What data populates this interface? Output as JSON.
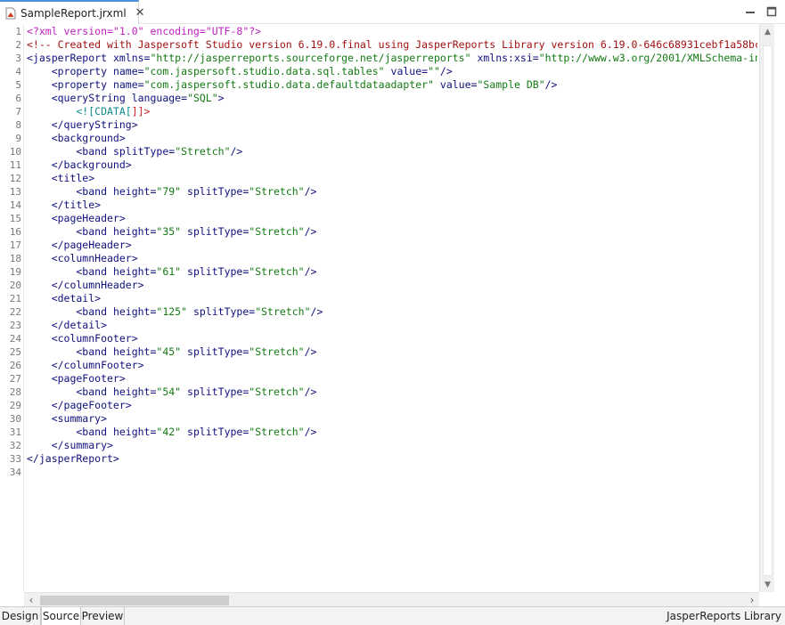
{
  "tab": {
    "filename": "SampleReport.jrxml",
    "icon": "jasper-report-icon",
    "close_icon": "close-icon"
  },
  "window_controls": [
    "minimize-icon",
    "maximize-icon"
  ],
  "line_numbers": [
    "1",
    "2",
    "3",
    "4",
    "5",
    "6",
    "7",
    "8",
    "9",
    "10",
    "11",
    "12",
    "13",
    "14",
    "15",
    "16",
    "17",
    "18",
    "19",
    "20",
    "21",
    "22",
    "23",
    "24",
    "25",
    "26",
    "27",
    "28",
    "29",
    "30",
    "31",
    "32",
    "33",
    "34"
  ],
  "code_lines": [
    [
      {
        "t": "<?xml version=\"1.0\" encoding=\"UTF-8\"?>",
        "c": "pi"
      }
    ],
    [
      {
        "t": "<!-- Created with Jaspersoft Studio version 6.19.0.final using JasperReports Library version 6.19.0-646c68931cebf1a58bc",
        "c": "comment"
      }
    ],
    [
      {
        "t": "<jasperReport ",
        "c": "tag"
      },
      {
        "t": "xmlns=",
        "c": "attr"
      },
      {
        "t": "\"http://jasperreports.sourceforge.net/jasperreports\"",
        "c": "val"
      },
      {
        "t": " xmlns:xsi=",
        "c": "attr"
      },
      {
        "t": "\"http://www.w3.org/2001/XMLSchema-ins",
        "c": "val"
      }
    ],
    [
      {
        "t": "    <property ",
        "c": "tag"
      },
      {
        "t": "name=",
        "c": "attr"
      },
      {
        "t": "\"com.jaspersoft.studio.data.sql.tables\"",
        "c": "val"
      },
      {
        "t": " value=",
        "c": "attr"
      },
      {
        "t": "\"\"",
        "c": "val"
      },
      {
        "t": "/>",
        "c": "tag"
      }
    ],
    [
      {
        "t": "    <property ",
        "c": "tag"
      },
      {
        "t": "name=",
        "c": "attr"
      },
      {
        "t": "\"com.jaspersoft.studio.data.defaultdataadapter\"",
        "c": "val"
      },
      {
        "t": " value=",
        "c": "attr"
      },
      {
        "t": "\"Sample DB\"",
        "c": "val"
      },
      {
        "t": "/>",
        "c": "tag"
      }
    ],
    [
      {
        "t": "    <queryString ",
        "c": "tag"
      },
      {
        "t": "language=",
        "c": "attr"
      },
      {
        "t": "\"SQL\"",
        "c": "val"
      },
      {
        "t": ">",
        "c": "tag"
      }
    ],
    [
      {
        "t": "        <![CDATA[",
        "c": "cdata"
      },
      {
        "t": "]]>",
        "c": "cdata-end"
      }
    ],
    [
      {
        "t": "    </queryString>",
        "c": "tag"
      }
    ],
    [
      {
        "t": "    <background>",
        "c": "tag"
      }
    ],
    [
      {
        "t": "        <band ",
        "c": "tag"
      },
      {
        "t": "splitType=",
        "c": "attr"
      },
      {
        "t": "\"Stretch\"",
        "c": "val"
      },
      {
        "t": "/>",
        "c": "tag"
      }
    ],
    [
      {
        "t": "    </background>",
        "c": "tag"
      }
    ],
    [
      {
        "t": "    <title>",
        "c": "tag"
      }
    ],
    [
      {
        "t": "        <band ",
        "c": "tag"
      },
      {
        "t": "height=",
        "c": "attr"
      },
      {
        "t": "\"79\"",
        "c": "val"
      },
      {
        "t": " splitType=",
        "c": "attr"
      },
      {
        "t": "\"Stretch\"",
        "c": "val"
      },
      {
        "t": "/>",
        "c": "tag"
      }
    ],
    [
      {
        "t": "    </title>",
        "c": "tag"
      }
    ],
    [
      {
        "t": "    <pageHeader>",
        "c": "tag"
      }
    ],
    [
      {
        "t": "        <band ",
        "c": "tag"
      },
      {
        "t": "height=",
        "c": "attr"
      },
      {
        "t": "\"35\"",
        "c": "val"
      },
      {
        "t": " splitType=",
        "c": "attr"
      },
      {
        "t": "\"Stretch\"",
        "c": "val"
      },
      {
        "t": "/>",
        "c": "tag"
      }
    ],
    [
      {
        "t": "    </pageHeader>",
        "c": "tag"
      }
    ],
    [
      {
        "t": "    <columnHeader>",
        "c": "tag"
      }
    ],
    [
      {
        "t": "        <band ",
        "c": "tag"
      },
      {
        "t": "height=",
        "c": "attr"
      },
      {
        "t": "\"61\"",
        "c": "val"
      },
      {
        "t": " splitType=",
        "c": "attr"
      },
      {
        "t": "\"Stretch\"",
        "c": "val"
      },
      {
        "t": "/>",
        "c": "tag"
      }
    ],
    [
      {
        "t": "    </columnHeader>",
        "c": "tag"
      }
    ],
    [
      {
        "t": "    <detail>",
        "c": "tag"
      }
    ],
    [
      {
        "t": "        <band ",
        "c": "tag"
      },
      {
        "t": "height=",
        "c": "attr"
      },
      {
        "t": "\"125\"",
        "c": "val"
      },
      {
        "t": " splitType=",
        "c": "attr"
      },
      {
        "t": "\"Stretch\"",
        "c": "val"
      },
      {
        "t": "/>",
        "c": "tag"
      }
    ],
    [
      {
        "t": "    </detail>",
        "c": "tag"
      }
    ],
    [
      {
        "t": "    <columnFooter>",
        "c": "tag"
      }
    ],
    [
      {
        "t": "        <band ",
        "c": "tag"
      },
      {
        "t": "height=",
        "c": "attr"
      },
      {
        "t": "\"45\"",
        "c": "val"
      },
      {
        "t": " splitType=",
        "c": "attr"
      },
      {
        "t": "\"Stretch\"",
        "c": "val"
      },
      {
        "t": "/>",
        "c": "tag"
      }
    ],
    [
      {
        "t": "    </columnFooter>",
        "c": "tag"
      }
    ],
    [
      {
        "t": "    <pageFooter>",
        "c": "tag"
      }
    ],
    [
      {
        "t": "        <band ",
        "c": "tag"
      },
      {
        "t": "height=",
        "c": "attr"
      },
      {
        "t": "\"54\"",
        "c": "val"
      },
      {
        "t": " splitType=",
        "c": "attr"
      },
      {
        "t": "\"Stretch\"",
        "c": "val"
      },
      {
        "t": "/>",
        "c": "tag"
      }
    ],
    [
      {
        "t": "    </pageFooter>",
        "c": "tag"
      }
    ],
    [
      {
        "t": "    <summary>",
        "c": "tag"
      }
    ],
    [
      {
        "t": "        <band ",
        "c": "tag"
      },
      {
        "t": "height=",
        "c": "attr"
      },
      {
        "t": "\"42\"",
        "c": "val"
      },
      {
        "t": " splitType=",
        "c": "attr"
      },
      {
        "t": "\"Stretch\"",
        "c": "val"
      },
      {
        "t": "/>",
        "c": "tag"
      }
    ],
    [
      {
        "t": "    </summary>",
        "c": "tag"
      }
    ],
    [
      {
        "t": "</jasperReport>",
        "c": "tag"
      }
    ],
    [
      {
        "t": "",
        "c": "tag"
      }
    ]
  ],
  "scrollbars": {
    "left_arrow": "‹",
    "right_arrow": "›",
    "up_arrow": "▲",
    "down_arrow": "▼"
  },
  "bottom_tabs": [
    {
      "label": "Design",
      "active": false
    },
    {
      "label": "Source",
      "active": true
    },
    {
      "label": "Preview",
      "active": false
    }
  ],
  "status": "JasperReports Library",
  "colors": {
    "pi": "#bf1fbf",
    "comment": "#a01010",
    "tag": "#10107f",
    "attr": "#10107f",
    "val": "#127a12",
    "cdata": "#0e8a8a",
    "cdata-end": "#c82020"
  }
}
